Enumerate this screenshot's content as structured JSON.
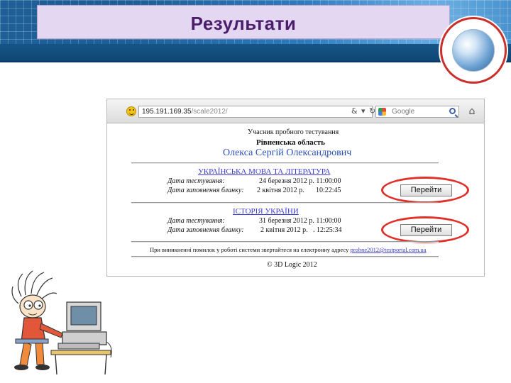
{
  "slide": {
    "title": "Результати"
  },
  "browser": {
    "url_host": "195.191.169.35",
    "url_path": "/scale2012/",
    "search_placeholder": "Google",
    "icon_names": [
      "smiley-icon",
      "bookmark-icon",
      "reload-icon",
      "google-icon",
      "magnifier-icon",
      "home-icon"
    ]
  },
  "page": {
    "participant_heading": "Учасник пробного тестування",
    "region": "Рівненська область",
    "name": "Олекса Сергій Олександрович",
    "subjects": [
      {
        "title": "УКРАЇНСЬКА МОВА ТА ЛІТЕРАТУРА",
        "test_date_label": "Дата тестування:",
        "test_date_value": "24 березня 2012 р. 11:00:00",
        "filled_label": "Дата заповнення бланку:",
        "filled_date": "2 квітня 2012 р.",
        "filled_time": "10:22:45",
        "button": "Перейти"
      },
      {
        "title": "ІСТОРІЯ УКРАЇНИ",
        "test_date_label": "Дата тестування:",
        "test_date_value": "31 березня 2012 р. 11:00:00",
        "filled_label": "Дата заповнення бланку:",
        "filled_date": "2 квітня 2012 р.",
        "filled_time": ". 12:25:34",
        "button": "Перейти"
      }
    ],
    "footer_note": "При виникненні помилок у роботі системи звертайтеся на електронну адресу",
    "footer_email": "probne2012@testportal.com.ua",
    "copyright": "© 3D Logic 2012"
  },
  "colors": {
    "header_blue": "#1d5f96",
    "title_bg": "#e3d7f1",
    "title_text": "#4b1d6b",
    "link": "#3b3bd6",
    "name_blue": "#2a4fb8",
    "highlight_ring": "#e0302a"
  }
}
